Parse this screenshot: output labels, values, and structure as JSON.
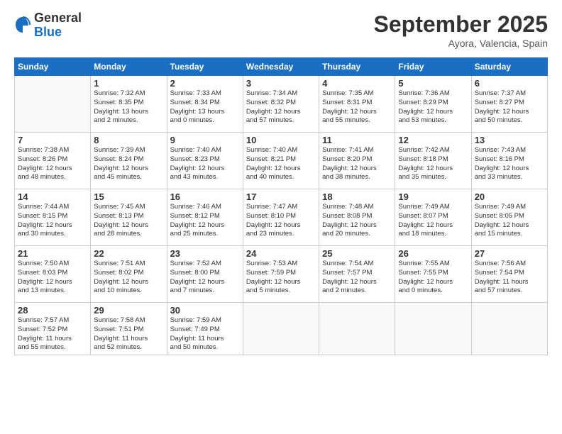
{
  "logo": {
    "general": "General",
    "blue": "Blue"
  },
  "title": "September 2025",
  "subtitle": "Ayora, Valencia, Spain",
  "days": [
    "Sunday",
    "Monday",
    "Tuesday",
    "Wednesday",
    "Thursday",
    "Friday",
    "Saturday"
  ],
  "weeks": [
    [
      {
        "date": "",
        "info": ""
      },
      {
        "date": "1",
        "info": "Sunrise: 7:32 AM\nSunset: 8:35 PM\nDaylight: 13 hours\nand 2 minutes."
      },
      {
        "date": "2",
        "info": "Sunrise: 7:33 AM\nSunset: 8:34 PM\nDaylight: 13 hours\nand 0 minutes."
      },
      {
        "date": "3",
        "info": "Sunrise: 7:34 AM\nSunset: 8:32 PM\nDaylight: 12 hours\nand 57 minutes."
      },
      {
        "date": "4",
        "info": "Sunrise: 7:35 AM\nSunset: 8:31 PM\nDaylight: 12 hours\nand 55 minutes."
      },
      {
        "date": "5",
        "info": "Sunrise: 7:36 AM\nSunset: 8:29 PM\nDaylight: 12 hours\nand 53 minutes."
      },
      {
        "date": "6",
        "info": "Sunrise: 7:37 AM\nSunset: 8:27 PM\nDaylight: 12 hours\nand 50 minutes."
      }
    ],
    [
      {
        "date": "7",
        "info": "Sunrise: 7:38 AM\nSunset: 8:26 PM\nDaylight: 12 hours\nand 48 minutes."
      },
      {
        "date": "8",
        "info": "Sunrise: 7:39 AM\nSunset: 8:24 PM\nDaylight: 12 hours\nand 45 minutes."
      },
      {
        "date": "9",
        "info": "Sunrise: 7:40 AM\nSunset: 8:23 PM\nDaylight: 12 hours\nand 43 minutes."
      },
      {
        "date": "10",
        "info": "Sunrise: 7:40 AM\nSunset: 8:21 PM\nDaylight: 12 hours\nand 40 minutes."
      },
      {
        "date": "11",
        "info": "Sunrise: 7:41 AM\nSunset: 8:20 PM\nDaylight: 12 hours\nand 38 minutes."
      },
      {
        "date": "12",
        "info": "Sunrise: 7:42 AM\nSunset: 8:18 PM\nDaylight: 12 hours\nand 35 minutes."
      },
      {
        "date": "13",
        "info": "Sunrise: 7:43 AM\nSunset: 8:16 PM\nDaylight: 12 hours\nand 33 minutes."
      }
    ],
    [
      {
        "date": "14",
        "info": "Sunrise: 7:44 AM\nSunset: 8:15 PM\nDaylight: 12 hours\nand 30 minutes."
      },
      {
        "date": "15",
        "info": "Sunrise: 7:45 AM\nSunset: 8:13 PM\nDaylight: 12 hours\nand 28 minutes."
      },
      {
        "date": "16",
        "info": "Sunrise: 7:46 AM\nSunset: 8:12 PM\nDaylight: 12 hours\nand 25 minutes."
      },
      {
        "date": "17",
        "info": "Sunrise: 7:47 AM\nSunset: 8:10 PM\nDaylight: 12 hours\nand 23 minutes."
      },
      {
        "date": "18",
        "info": "Sunrise: 7:48 AM\nSunset: 8:08 PM\nDaylight: 12 hours\nand 20 minutes."
      },
      {
        "date": "19",
        "info": "Sunrise: 7:49 AM\nSunset: 8:07 PM\nDaylight: 12 hours\nand 18 minutes."
      },
      {
        "date": "20",
        "info": "Sunrise: 7:49 AM\nSunset: 8:05 PM\nDaylight: 12 hours\nand 15 minutes."
      }
    ],
    [
      {
        "date": "21",
        "info": "Sunrise: 7:50 AM\nSunset: 8:03 PM\nDaylight: 12 hours\nand 13 minutes."
      },
      {
        "date": "22",
        "info": "Sunrise: 7:51 AM\nSunset: 8:02 PM\nDaylight: 12 hours\nand 10 minutes."
      },
      {
        "date": "23",
        "info": "Sunrise: 7:52 AM\nSunset: 8:00 PM\nDaylight: 12 hours\nand 7 minutes."
      },
      {
        "date": "24",
        "info": "Sunrise: 7:53 AM\nSunset: 7:59 PM\nDaylight: 12 hours\nand 5 minutes."
      },
      {
        "date": "25",
        "info": "Sunrise: 7:54 AM\nSunset: 7:57 PM\nDaylight: 12 hours\nand 2 minutes."
      },
      {
        "date": "26",
        "info": "Sunrise: 7:55 AM\nSunset: 7:55 PM\nDaylight: 12 hours\nand 0 minutes."
      },
      {
        "date": "27",
        "info": "Sunrise: 7:56 AM\nSunset: 7:54 PM\nDaylight: 11 hours\nand 57 minutes."
      }
    ],
    [
      {
        "date": "28",
        "info": "Sunrise: 7:57 AM\nSunset: 7:52 PM\nDaylight: 11 hours\nand 55 minutes."
      },
      {
        "date": "29",
        "info": "Sunrise: 7:58 AM\nSunset: 7:51 PM\nDaylight: 11 hours\nand 52 minutes."
      },
      {
        "date": "30",
        "info": "Sunrise: 7:59 AM\nSunset: 7:49 PM\nDaylight: 11 hours\nand 50 minutes."
      },
      {
        "date": "",
        "info": ""
      },
      {
        "date": "",
        "info": ""
      },
      {
        "date": "",
        "info": ""
      },
      {
        "date": "",
        "info": ""
      }
    ]
  ]
}
